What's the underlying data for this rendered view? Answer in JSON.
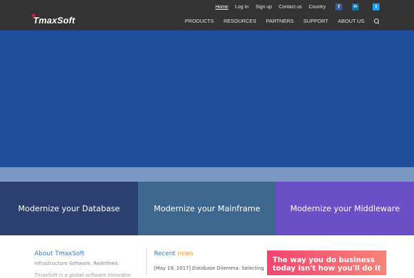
{
  "header": {
    "logo_text": "TmaxSoft",
    "utility_links": [
      "Home",
      "Log In",
      "Sign up",
      "Contact us",
      "Country"
    ],
    "social": {
      "facebook": "f",
      "linkedin": "in",
      "twitter": "t"
    },
    "nav": [
      "PRODUCTS",
      "RESOURCES",
      "PARTNERS",
      "SUPPORT",
      "ABOUT US"
    ]
  },
  "tiles": [
    {
      "label": "Modernize your Database",
      "color": "#2b3f70"
    },
    {
      "label": "Modernize your Mainframe",
      "color": "#3d678f"
    },
    {
      "label": "Modernize your Middleware",
      "color": "#6a4fc7"
    }
  ],
  "about": {
    "title_prefix": "About ",
    "title_brand": "TmaxSoft",
    "subtitle": "Infrastructure Software, Redefined.",
    "text": "TmaxSoft is a global software innovator"
  },
  "news": {
    "title_prefix": "Recent ",
    "title_suffix": "news",
    "item": "[May 19, 2017] Database Dilemma: Selecting"
  },
  "promo": {
    "text": "The way you do business today isn't how you'll do it"
  },
  "colors": {
    "topbar": "#333333",
    "hero": "#1f4f9b",
    "hero_strip": "#7a96c3",
    "accent": "#3a78c2"
  }
}
